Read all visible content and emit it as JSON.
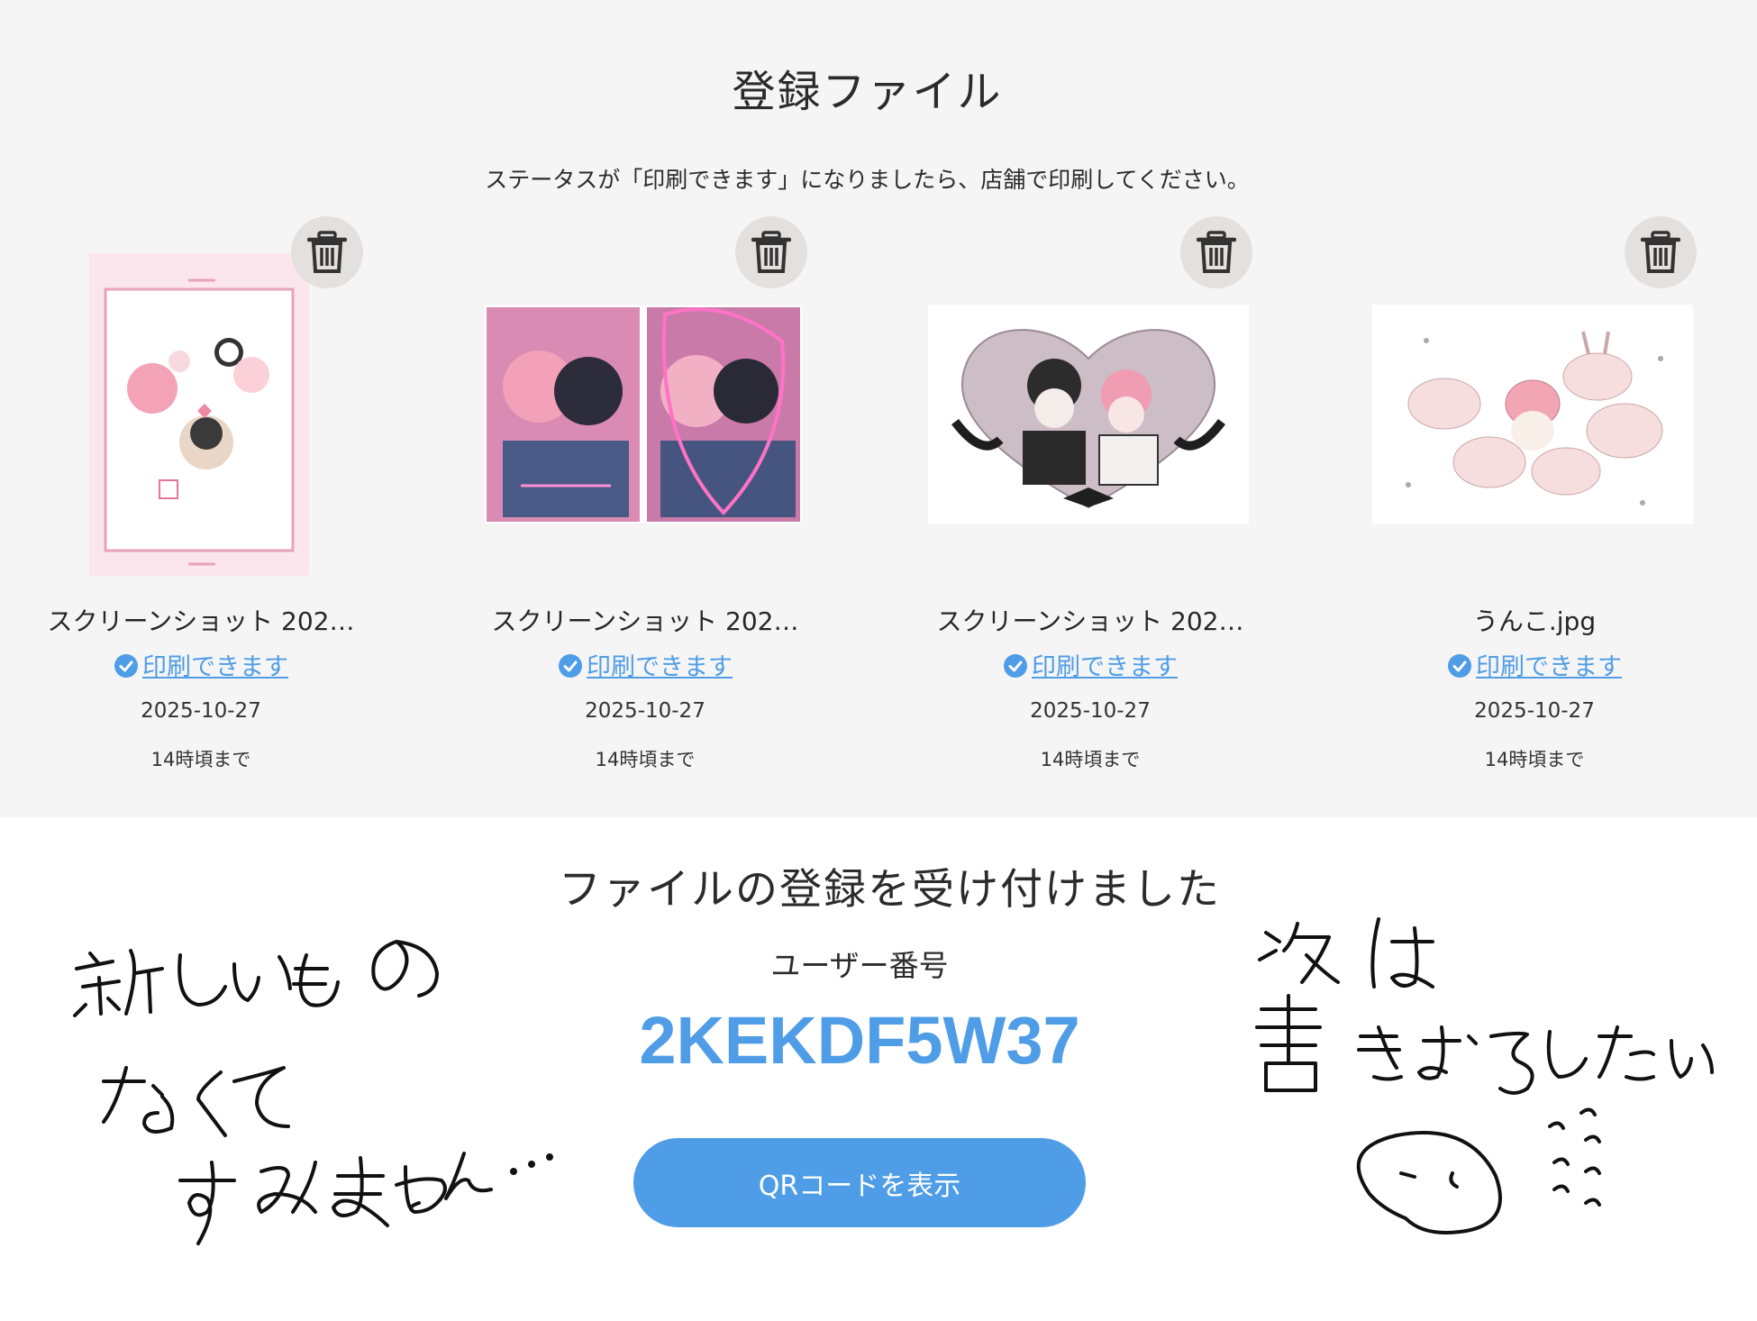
{
  "header": {
    "title": "登録ファイル",
    "instruction": "ステータスが「印刷できます」になりましたら、店舗で印刷してください。"
  },
  "files": [
    {
      "name": "スクリーンショット 202…",
      "status": "印刷できます",
      "date": "2025-10-27",
      "deadline": "14時頃まで",
      "thumbnail": "pink-poster-illustration"
    },
    {
      "name": "スクリーンショット 202…",
      "status": "印刷できます",
      "date": "2025-10-27",
      "deadline": "14時頃まで",
      "thumbnail": "neon-comic-covers"
    },
    {
      "name": "スクリーンショット 202…",
      "status": "印刷できます",
      "date": "2025-10-27",
      "deadline": "14時頃まで",
      "thumbnail": "heart-frame-illustration"
    },
    {
      "name": "うんこ.jpg",
      "status": "印刷できます",
      "date": "2025-10-27",
      "deadline": "14時頃まで",
      "thumbnail": "bunnies-sketch"
    }
  ],
  "icons": {
    "delete": "trash-icon",
    "status": "check-circle-icon"
  },
  "colors": {
    "accent": "#4f9de6",
    "panel_bg": "#f6f5f5",
    "delete_bg": "#e3e1e0"
  },
  "confirmation": {
    "title": "ファイルの登録を受け付けました",
    "user_number_label": "ユーザー番号",
    "user_number": "2KEKDF5W37",
    "qr_button_label": "QRコードを表示"
  },
  "handwriting": {
    "left_note": "新しいもの なくて すみません…",
    "right_note": "次は 書きおろしたい"
  }
}
